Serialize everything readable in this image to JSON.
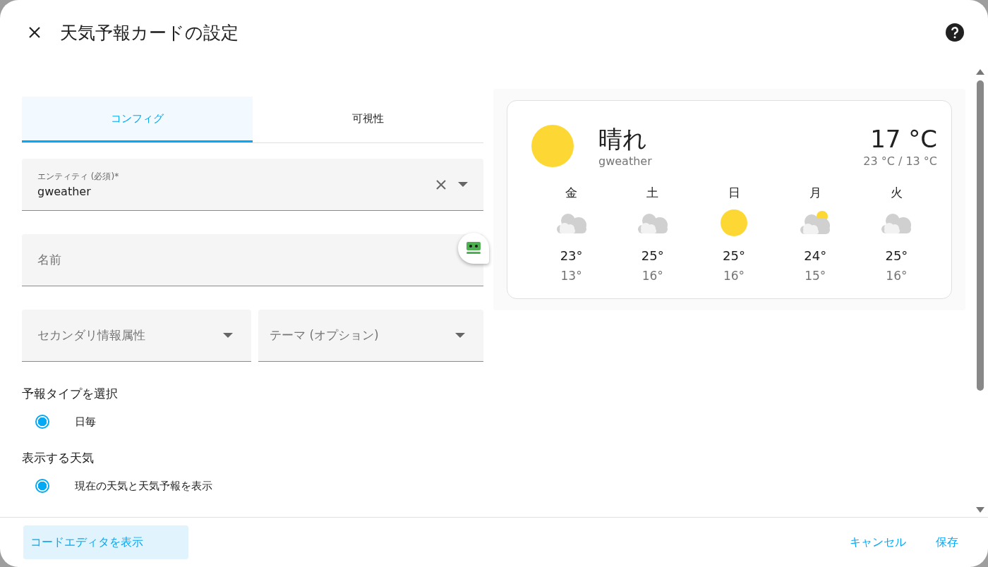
{
  "dialog": {
    "title": "天気予報カードの設定"
  },
  "tabs": [
    {
      "label": "コンフィグ",
      "selected": true
    },
    {
      "label": "可視性",
      "selected": false
    }
  ],
  "entity_field": {
    "label": "エンティティ (必須)*",
    "value": "gweather"
  },
  "name_field": {
    "placeholder": "名前"
  },
  "selects": [
    {
      "placeholder": "セカンダリ情報属性"
    },
    {
      "placeholder": "テーマ (オプション)"
    }
  ],
  "forecast_type": {
    "heading": "予報タイプを選択",
    "options": [
      {
        "label": "日毎",
        "selected": true
      }
    ]
  },
  "show_weather": {
    "heading": "表示する天気",
    "options": [
      {
        "label": "現在の天気と天気予報を表示",
        "selected": true
      }
    ]
  },
  "preview": {
    "condition": "晴れ",
    "kind": "sunny",
    "entity": "gweather",
    "temperature": "17 °C",
    "high_low": "23 °C / 13 °C",
    "forecast": [
      {
        "day": "金",
        "kind": "cloudy",
        "high": "23°",
        "low": "13°"
      },
      {
        "day": "土",
        "kind": "cloudy",
        "high": "25°",
        "low": "16°"
      },
      {
        "day": "日",
        "kind": "sunny",
        "high": "25°",
        "low": "16°"
      },
      {
        "day": "月",
        "kind": "partly-cloudy",
        "high": "24°",
        "low": "15°"
      },
      {
        "day": "火",
        "kind": "cloudy",
        "high": "25°",
        "low": "16°"
      }
    ]
  },
  "footer": {
    "code_editor": "コードエディタを表示",
    "cancel": "キャンセル",
    "save": "保存"
  }
}
